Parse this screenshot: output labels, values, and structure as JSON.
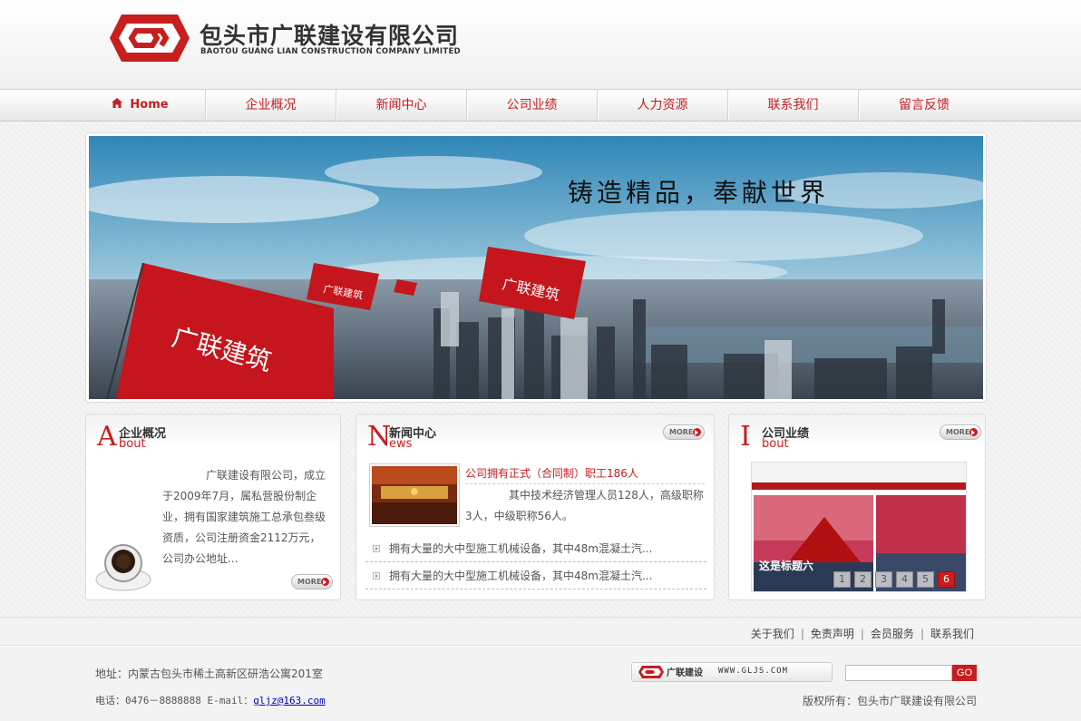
{
  "colors": {
    "brand": "#c81e1e",
    "text": "#444444"
  },
  "header": {
    "company_cn": "包头市广联建设有限公司",
    "company_en": "BAOTOU GUANG LIAN CONSTRUCTION COMPANY LIMITED",
    "logo_icon": "guanglian-logo"
  },
  "nav": {
    "items": [
      {
        "label": "Home",
        "icon": "home-icon"
      },
      {
        "label": "企业概况"
      },
      {
        "label": "新闻中心"
      },
      {
        "label": "公司业绩"
      },
      {
        "label": "人力资源"
      },
      {
        "label": "联系我们"
      },
      {
        "label": "留言反馈"
      }
    ]
  },
  "banner": {
    "slogan": "铸造精品，奉献世界",
    "flag_text": "广联建筑"
  },
  "about": {
    "letter": "A",
    "title_cn": "企业概况",
    "title_en": "bout",
    "text": "广联建设有限公司，成立于2009年7月，属私营股份制企业，拥有国家建筑施工总承包叁级资质，公司注册资金2112万元，公司办公地址...",
    "more": "MORE"
  },
  "news": {
    "letter": "N",
    "title_cn": "新闻中心",
    "title_en": "ews",
    "more": "MORE",
    "headline": "公司拥有正式（合同制）职工186人",
    "summary": "其中技术经济管理人员128人，高级职称3人，中级职称56人。",
    "items": [
      "拥有大量的大中型施工机械设备，其中48m混凝土汽...",
      "拥有大量的大中型施工机械设备，其中48m混凝土汽..."
    ]
  },
  "performance": {
    "letter": "I",
    "title_cn": "公司业绩",
    "title_en": "bout",
    "more": "MORE",
    "caption": "这是标题六",
    "pages": [
      "1",
      "2",
      "3",
      "4",
      "5",
      "6"
    ],
    "active_page": "6"
  },
  "footer": {
    "links": [
      "关于我们",
      "免责声明",
      "会员服务",
      "联系我们"
    ],
    "address": "地址：内蒙古包头市稀土高新区研浩公寓201室",
    "phone": "电话：0476－8888888 E-mail：",
    "email": "gljz@163.com",
    "logo_cn": "广联建设",
    "logo_url": "WWW.GLJS.COM",
    "search_placeholder": "",
    "go": "GO",
    "copyright": "版权所有：包头市广联建设有限公司"
  }
}
